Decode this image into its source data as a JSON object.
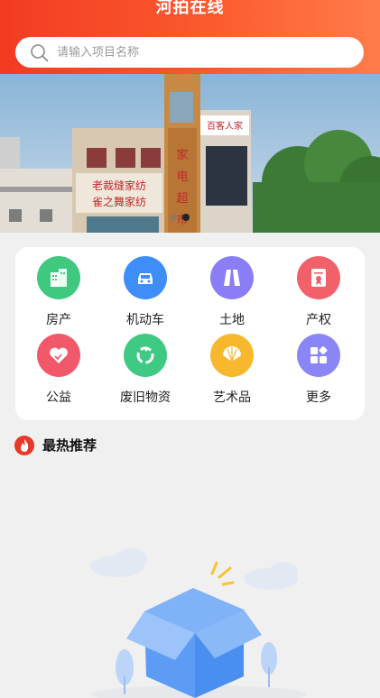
{
  "header": {
    "title": "河拍在线",
    "background": "#f2421f",
    "search": {
      "placeholder": "请输入项目名称",
      "value": ""
    }
  },
  "banner": {
    "image": "storefront photo",
    "signs": [
      "老裁缝家纺",
      "雀之舞家纺",
      "家电超市",
      "百客人家"
    ],
    "slide_count": 2,
    "active_index": 1
  },
  "categories": [
    {
      "label": "房产",
      "icon": "building-icon",
      "color": "#3fc97f"
    },
    {
      "label": "机动车",
      "icon": "car-icon",
      "color": "#3f8dfa"
    },
    {
      "label": "土地",
      "icon": "land-icon",
      "color": "#8a7df5"
    },
    {
      "label": "产权",
      "icon": "certificate-icon",
      "color": "#f2606a"
    },
    {
      "label": "公益",
      "icon": "heart-icon",
      "color": "#f1586a"
    },
    {
      "label": "废旧物资",
      "icon": "recycle-icon",
      "color": "#3fca84"
    },
    {
      "label": "艺术品",
      "icon": "fan-icon",
      "color": "#f7b82e"
    },
    {
      "label": "更多",
      "icon": "more-grid-icon",
      "color": "#8b86f7"
    }
  ],
  "hot": {
    "title": "最热推荐",
    "icon": "fire-icon",
    "color": "#e8372b"
  },
  "empty_state": {
    "icon": "empty-box-icon",
    "color": "#5c9cf5"
  }
}
